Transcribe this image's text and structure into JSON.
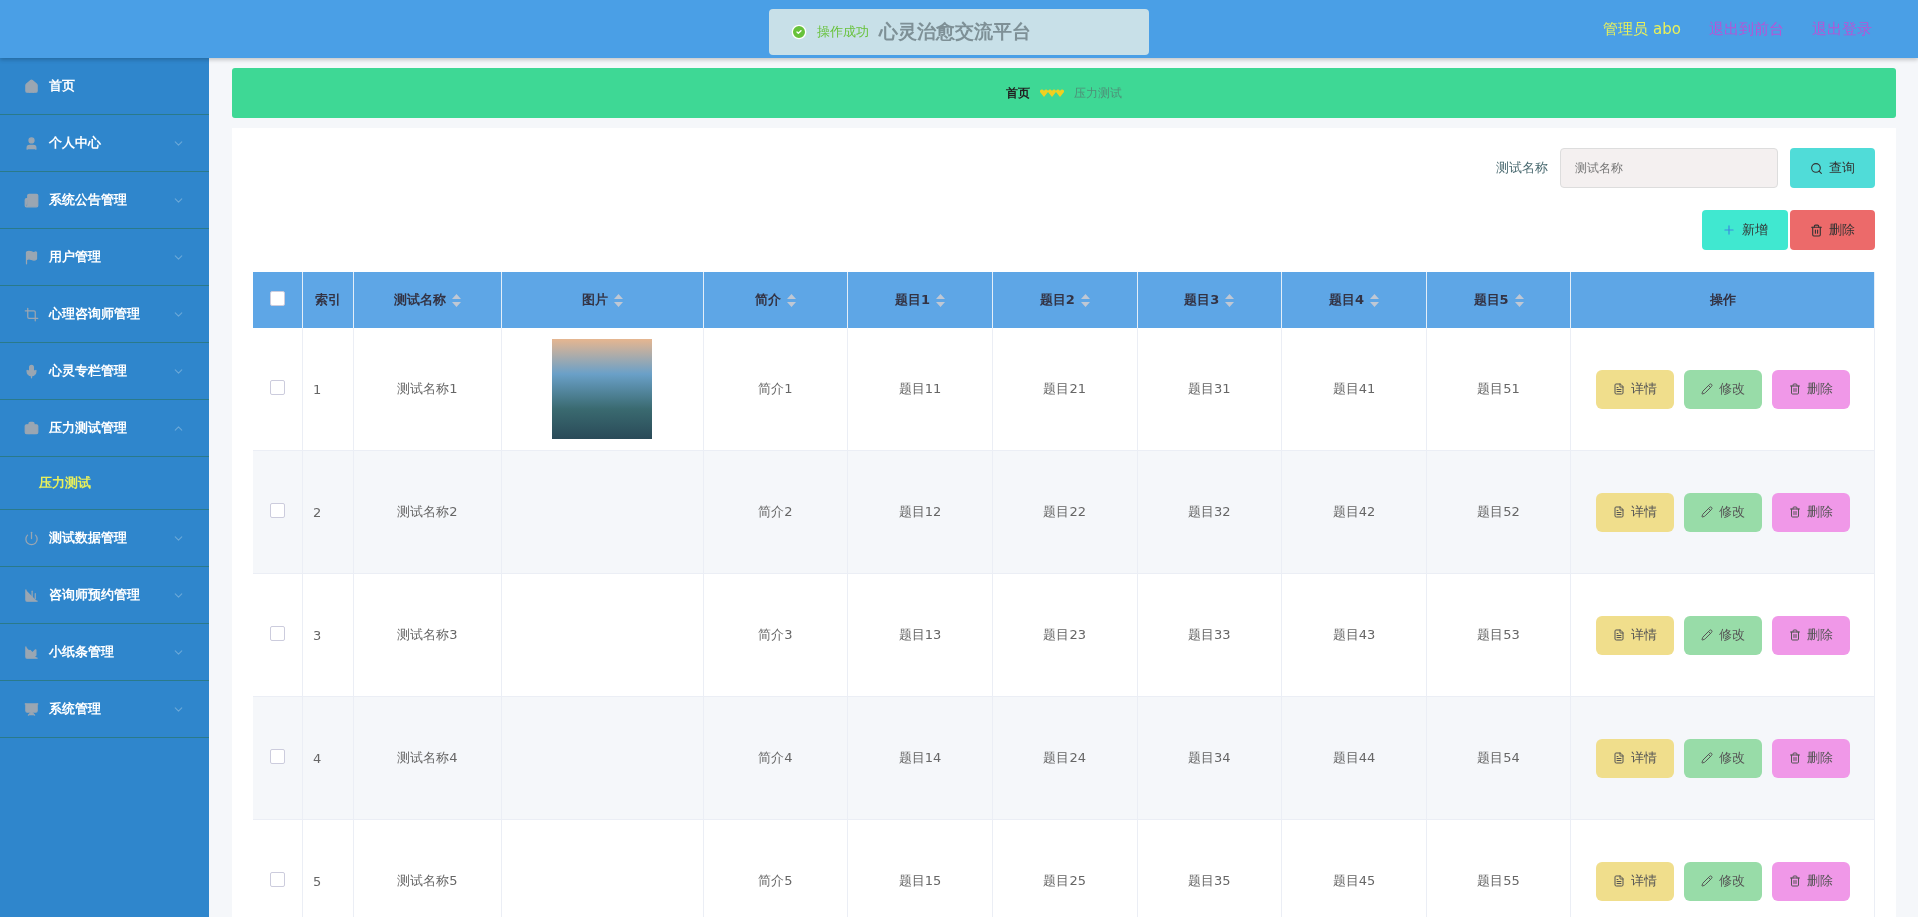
{
  "header": {
    "title": "心灵治愈交流平台",
    "user": "管理员 abo",
    "links": [
      "退出到前台",
      "退出登录"
    ]
  },
  "toast": {
    "message": "操作成功"
  },
  "sidebar": {
    "items": [
      {
        "label": "首页",
        "kind": "link"
      },
      {
        "label": "个人中心",
        "kind": "menu",
        "expanded": false
      },
      {
        "label": "系统公告管理",
        "kind": "menu",
        "expanded": false
      },
      {
        "label": "用户管理",
        "kind": "menu",
        "expanded": false
      },
      {
        "label": "心理咨询师管理",
        "kind": "menu",
        "expanded": false
      },
      {
        "label": "心灵专栏管理",
        "kind": "menu",
        "expanded": false
      },
      {
        "label": "压力测试管理",
        "kind": "menu",
        "expanded": true,
        "children": [
          {
            "label": "压力测试",
            "selected": true
          }
        ]
      },
      {
        "label": "测试数据管理",
        "kind": "menu",
        "expanded": false
      },
      {
        "label": "咨询师预约管理",
        "kind": "menu",
        "expanded": false
      },
      {
        "label": "小纸条管理",
        "kind": "menu",
        "expanded": false
      },
      {
        "label": "系统管理",
        "kind": "menu",
        "expanded": false
      }
    ]
  },
  "breadcrumb": [
    "首页",
    "压力测试"
  ],
  "search": {
    "label": "测试名称",
    "placeholder": "测试名称",
    "button": "查询"
  },
  "toolbar": [
    "新增",
    "删除"
  ],
  "table": {
    "select_all_checked": false,
    "columns": [
      {
        "label": "索引",
        "sortable": false
      },
      {
        "label": "测试名称",
        "sortable": true
      },
      {
        "label": "图片",
        "sortable": true
      },
      {
        "label": "简介",
        "sortable": true
      },
      {
        "label": "题目1",
        "sortable": true
      },
      {
        "label": "题目2",
        "sortable": true
      },
      {
        "label": "题目3",
        "sortable": true
      },
      {
        "label": "题目4",
        "sortable": true
      },
      {
        "label": "题目5",
        "sortable": true
      },
      {
        "label": "操作",
        "sortable": false
      }
    ],
    "rows": [
      {
        "checked": false,
        "cells": [
          "1",
          "测试名称1",
          "",
          "简介1",
          "题目11",
          "题目21",
          "题目31",
          "题目41",
          "题目51"
        ],
        "has_image": true,
        "actions": [
          "详情",
          "修改",
          "删除"
        ]
      },
      {
        "checked": false,
        "cells": [
          "2",
          "测试名称2",
          "",
          "简介2",
          "题目12",
          "题目22",
          "题目32",
          "题目42",
          "题目52"
        ],
        "has_image": false,
        "actions": [
          "详情",
          "修改",
          "删除"
        ]
      },
      {
        "checked": false,
        "cells": [
          "3",
          "测试名称3",
          "",
          "简介3",
          "题目13",
          "题目23",
          "题目33",
          "题目43",
          "题目53"
        ],
        "has_image": false,
        "actions": [
          "详情",
          "修改",
          "删除"
        ]
      },
      {
        "checked": false,
        "cells": [
          "4",
          "测试名称4",
          "",
          "简介4",
          "题目14",
          "题目24",
          "题目34",
          "题目44",
          "题目54"
        ],
        "has_image": false,
        "actions": [
          "详情",
          "修改",
          "删除"
        ]
      },
      {
        "checked": false,
        "cells": [
          "5",
          "测试名称5",
          "",
          "简介5",
          "题目15",
          "题目25",
          "题目35",
          "题目45",
          "题目55"
        ],
        "has_image": false,
        "actions": [
          "详情",
          "修改",
          "删除"
        ]
      }
    ]
  }
}
